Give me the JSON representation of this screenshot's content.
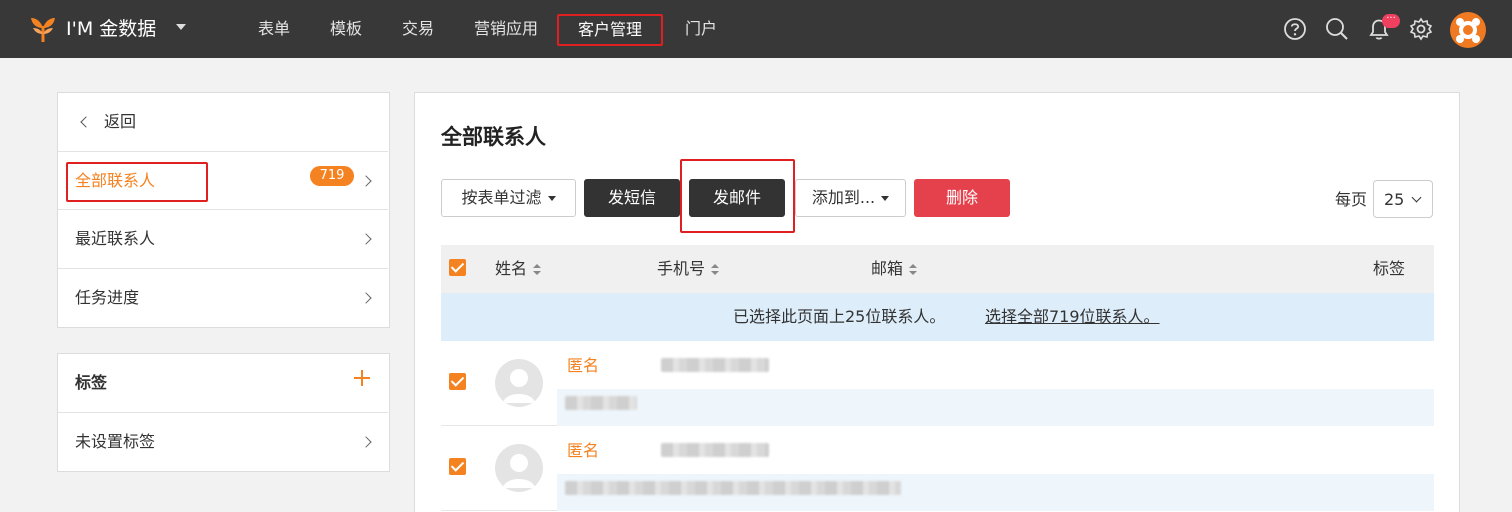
{
  "app": {
    "brand": "I'M 金数据",
    "nav": [
      "表单",
      "模板",
      "交易",
      "营销应用",
      "客户管理",
      "门户"
    ],
    "notification_badge": "···"
  },
  "sidebar": {
    "back_label": "返回",
    "items": [
      {
        "label": "全部联系人",
        "count": "719"
      },
      {
        "label": "最近联系人"
      },
      {
        "label": "任务进度"
      }
    ],
    "tags_section": {
      "title": "标签",
      "items": [
        {
          "label": "未设置标签"
        }
      ]
    }
  },
  "main": {
    "title": "全部联系人",
    "toolbar": {
      "filter_label": "按表单过滤",
      "sms_label": "发短信",
      "email_label": "发邮件",
      "add_to_label": "添加到...",
      "delete_label": "删除",
      "per_page_label": "每页",
      "per_page_value": "25"
    },
    "table": {
      "columns": [
        "姓名",
        "手机号",
        "邮箱",
        "标签"
      ],
      "banner": {
        "text": "已选择此页面上25位联系人。",
        "link": "选择全部719位联系人。"
      },
      "rows": [
        {
          "name": "匿名",
          "checked": true
        },
        {
          "name": "匿名",
          "checked": true
        }
      ]
    }
  },
  "colors": {
    "accent": "#f58220",
    "topbar": "#383838",
    "danger": "#e5414c",
    "highlight_box": "#e02020"
  },
  "icons": [
    "help-icon",
    "search-icon",
    "bell-icon",
    "gear-icon",
    "chevron-left-icon",
    "chevron-right-icon",
    "plus-icon",
    "caret-down-icon",
    "sort-icon"
  ]
}
